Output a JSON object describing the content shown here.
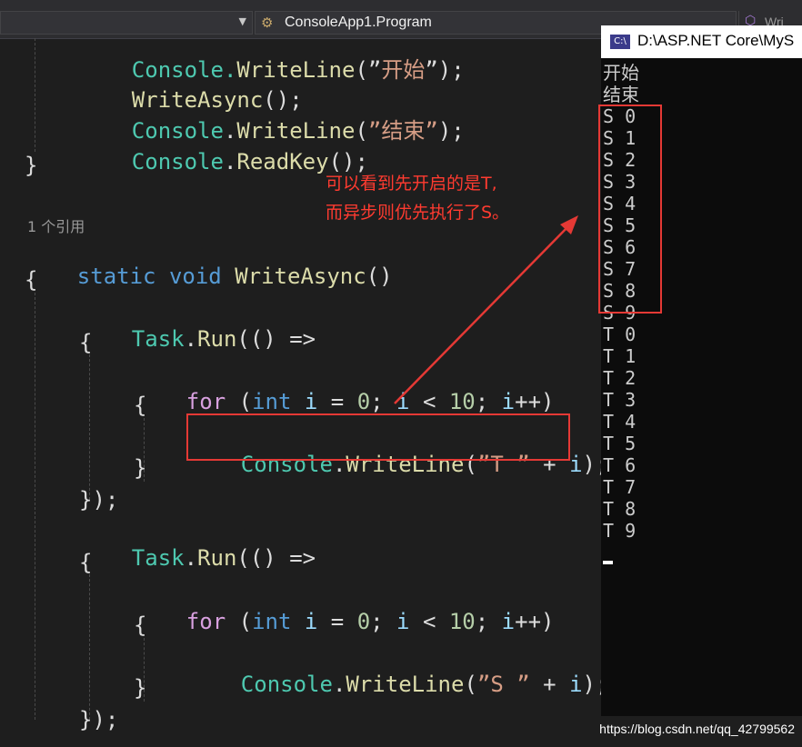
{
  "toolbar": {
    "left_dropdown": "",
    "class_selector": "ConsoleApp1.Program",
    "right_tab_partial": "Wri"
  },
  "code": {
    "line0": [
      "Console.",
      "WriteLine",
      "(”",
      "开始",
      "”);"
    ],
    "line1": [
      "WriteAsync",
      "();"
    ],
    "line2": [
      "Console",
      ".",
      "WriteLine",
      "(",
      "”结束”",
      ");"
    ],
    "line3": [
      "Console",
      ".",
      "ReadKey",
      "();"
    ],
    "line4": "}",
    "reference_count": "1 个引用",
    "line5": [
      "static",
      " ",
      "void",
      " ",
      "WriteAsync",
      "()"
    ],
    "line6": "{",
    "line7": [
      "Task",
      ".",
      "Run",
      "(() =>"
    ],
    "line8": "{",
    "line9": [
      "for",
      " (",
      "int",
      " ",
      "i",
      " = ",
      "0",
      "; ",
      "i",
      " < ",
      "10",
      "; ",
      "i",
      "++)"
    ],
    "line10": "{",
    "line11": [
      "Console",
      ".",
      "WriteLine",
      "(",
      "”T ”",
      " + ",
      "i",
      ");"
    ],
    "line12": "}",
    "line13": "});",
    "line14": [
      "Task",
      ".",
      "Run",
      "(() =>"
    ],
    "line15": "{",
    "line16": [
      "for",
      " (",
      "int",
      " ",
      "i",
      " = ",
      "0",
      "; ",
      "i",
      " < ",
      "10",
      "; ",
      "i",
      "++)"
    ],
    "line17": "{",
    "line18": [
      "Console",
      ".",
      "WriteLine",
      "(",
      "”S ”",
      " + ",
      "i",
      ");"
    ],
    "line19": "}",
    "line20": "});"
  },
  "console": {
    "title": "D:\\ASP.NET Core\\MyS",
    "icon_text": "C:\\",
    "output": [
      "开始",
      "结束",
      "S 0",
      "S 1",
      "S 2",
      "S 3",
      "S 4",
      "S 5",
      "S 6",
      "S 7",
      "S 8",
      "S 9",
      "T 0",
      "T 1",
      "T 2",
      "T 3",
      "T 4",
      "T 5",
      "T 6",
      "T 7",
      "T 8",
      "T 9"
    ]
  },
  "annotation": {
    "text_line1": "可以看到先开启的是T,",
    "text_line2": "而异步则优先执行了S。",
    "color": "#ff3b30"
  },
  "watermark": "https://blog.csdn.net/qq_42799562",
  "colors": {
    "keyword": "#569cd6",
    "control": "#d8a0df",
    "type": "#4ec9b0",
    "method": "#dcdcaa",
    "string": "#d69d85",
    "number": "#b5cea8",
    "highlight": "#e53935"
  }
}
